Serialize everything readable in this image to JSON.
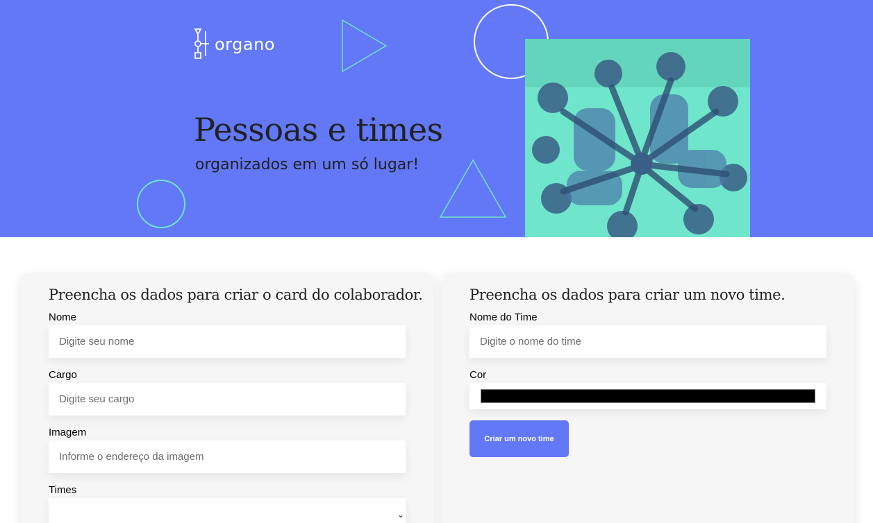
{
  "brand": {
    "name": "organo",
    "primary_color": "#6278f7",
    "accent_color": "#6fe6cb"
  },
  "banner": {
    "headline": "Pessoas e times",
    "subheadline": "organizados em um só lugar!",
    "photo": "team-hands-together-photo"
  },
  "collaborator_form": {
    "title": "Preencha os dados para criar o card do colaborador.",
    "fields": [
      {
        "label": "Nome",
        "placeholder": "Digite seu nome",
        "value": ""
      },
      {
        "label": "Cargo",
        "placeholder": "Digite seu cargo",
        "value": ""
      },
      {
        "label": "Imagem",
        "placeholder": "Informe o endereço da imagem",
        "value": ""
      }
    ],
    "select": {
      "label": "Times",
      "value": "",
      "icon": "chevron-down-icon"
    }
  },
  "team_form": {
    "title": "Preencha os dados para criar um novo time.",
    "name_field": {
      "label": "Nome do Time",
      "placeholder": "Digite o nome do time",
      "value": ""
    },
    "color_field": {
      "label": "Cor",
      "value": "#000000"
    },
    "submit_label": "Criar um novo time"
  }
}
